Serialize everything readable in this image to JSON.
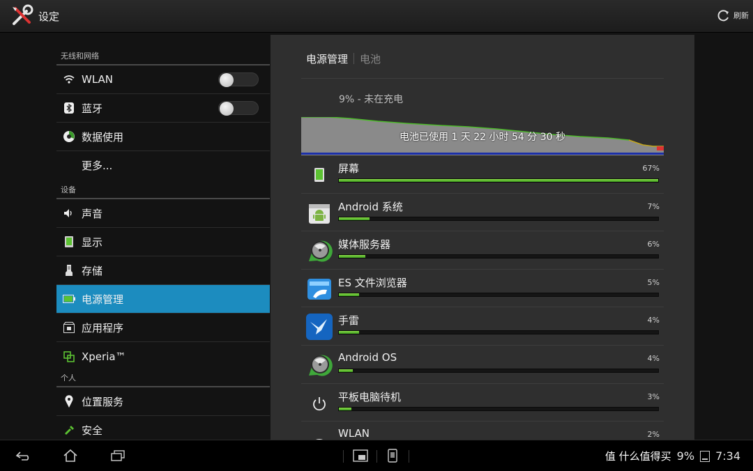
{
  "app": {
    "title": "设定",
    "refresh_label": "刷新"
  },
  "sidebar": {
    "sections": [
      {
        "header": "无线和网络",
        "items": [
          {
            "label": "WLAN",
            "icon": "wifi-icon",
            "toggle": true
          },
          {
            "label": "蓝牙",
            "icon": "bluetooth-icon",
            "toggle": true
          },
          {
            "label": "数据使用",
            "icon": "data-usage-icon"
          },
          {
            "label": "更多...",
            "icon": ""
          }
        ]
      },
      {
        "header": "设备",
        "items": [
          {
            "label": "声音",
            "icon": "volume-icon"
          },
          {
            "label": "显示",
            "icon": "display-icon"
          },
          {
            "label": "存储",
            "icon": "storage-icon"
          },
          {
            "label": "电源管理",
            "icon": "battery-icon",
            "active": true
          },
          {
            "label": "应用程序",
            "icon": "apps-icon"
          },
          {
            "label": "Xperia™",
            "icon": "xperia-icon"
          }
        ]
      },
      {
        "header": "个人",
        "items": [
          {
            "label": "位置服务",
            "icon": "location-icon"
          },
          {
            "label": "安全",
            "icon": "security-icon"
          }
        ]
      }
    ]
  },
  "main": {
    "breadcrumb_current": "电源管理",
    "breadcrumb_sub": "电池",
    "battery_status": "9% - 未在充电",
    "battery_duration": "电池已使用 1 天 22 小时 54 分 30 秒",
    "usage": [
      {
        "name": "屏幕",
        "percent": "67%",
        "fraction": 1.0,
        "icon": "screen-icon"
      },
      {
        "name": "Android 系统",
        "percent": "7%",
        "fraction": 0.095,
        "icon": "android-system-icon"
      },
      {
        "name": "媒体服务器",
        "percent": "6%",
        "fraction": 0.083,
        "icon": "media-server-icon"
      },
      {
        "name": "ES 文件浏览器",
        "percent": "5%",
        "fraction": 0.063,
        "icon": "es-file-explorer-icon"
      },
      {
        "name": "手雷",
        "percent": "4%",
        "fraction": 0.063,
        "icon": "xunlei-icon"
      },
      {
        "name": "Android OS",
        "percent": "4%",
        "fraction": 0.044,
        "icon": "android-os-icon"
      },
      {
        "name": "平板电脑待机",
        "percent": "3%",
        "fraction": 0.04,
        "icon": "power-icon"
      },
      {
        "name": "WLAN",
        "percent": "2%",
        "fraction": 0.03,
        "icon": "wifi-icon"
      }
    ]
  },
  "statusbar": {
    "time": "7:34",
    "battery_text": "9%",
    "watermark": "值 什么值得买"
  },
  "colors": {
    "accent": "#1c8cbf",
    "bar_green": "#6cc43a",
    "panel_bg": "#2f2f2f"
  }
}
